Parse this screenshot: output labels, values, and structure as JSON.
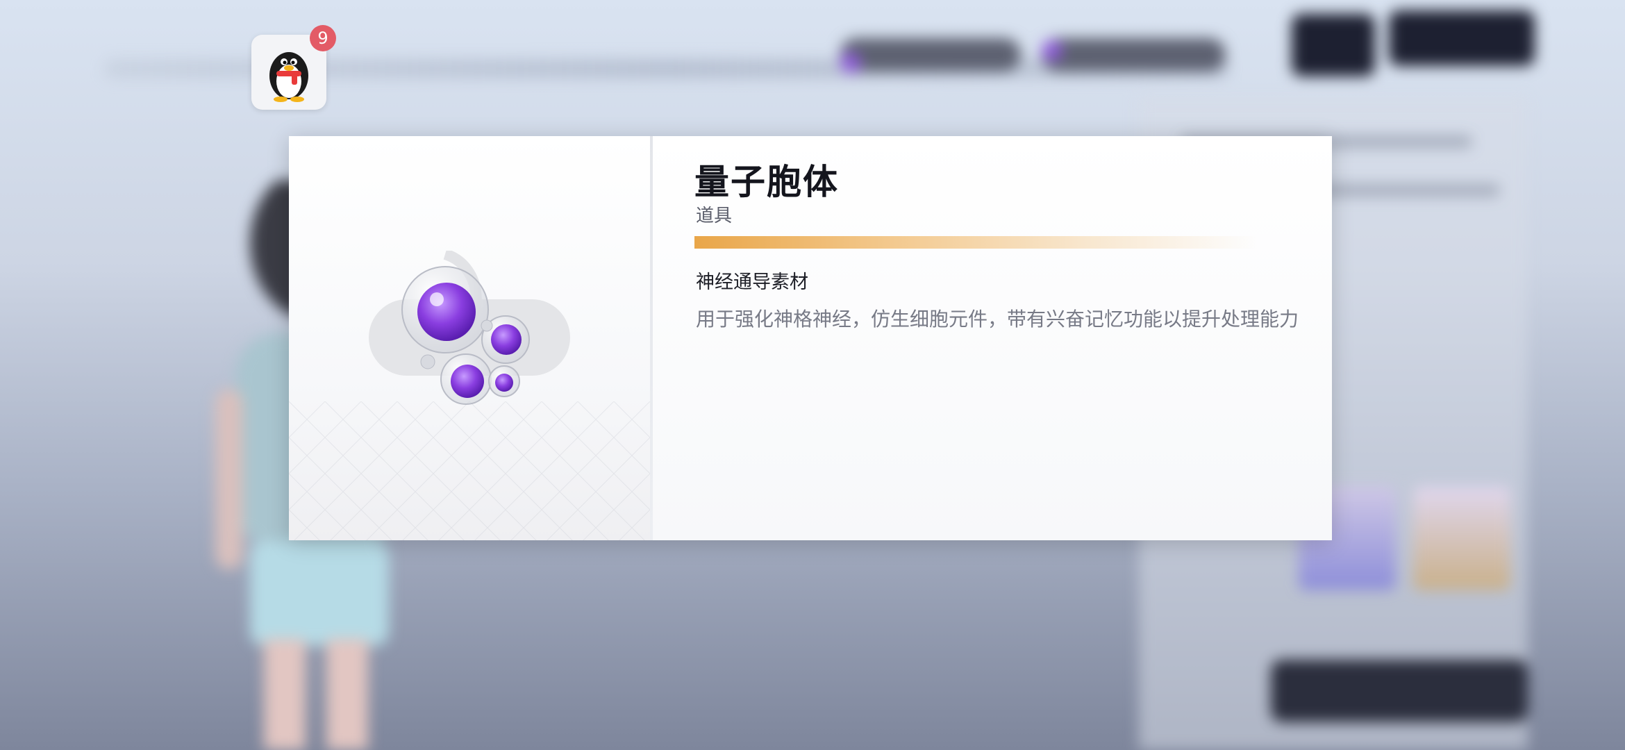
{
  "notification": {
    "app_icon": "qq-penguin-icon",
    "badge_count": "9"
  },
  "item": {
    "name": "量子胞体",
    "category": "道具",
    "rarity_color": "#e9a649",
    "section_title": "神经通导素材",
    "description": "用于强化神格神经，仿生细胞元件，带有兴奋记忆功能以提升处理能力",
    "image_icon": "quantum-cell-icon"
  },
  "colors": {
    "accent_purple": "#8e5bd9",
    "badge_red": "#e35b66"
  }
}
